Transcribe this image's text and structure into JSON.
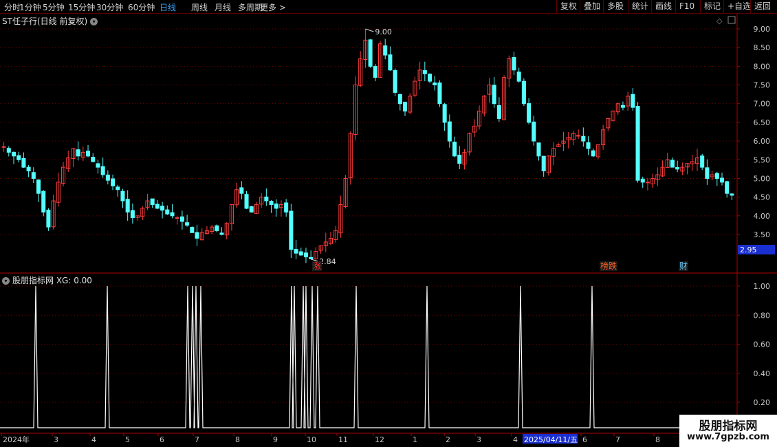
{
  "toolbar": {
    "periods": [
      "分时",
      "1分钟",
      "5分钟",
      "15分钟",
      "30分钟",
      "60分钟",
      "日线",
      "周线",
      "月线",
      "多周期",
      "更多 >"
    ],
    "active_period": "日线",
    "right_buttons": [
      "复权",
      "叠加",
      "多股",
      "统计",
      "画线",
      "F10",
      "标记",
      "+自选",
      "返回"
    ]
  },
  "main_chart": {
    "title": "ST任子行(日线 前复权)",
    "high_label": "9.00",
    "low_label": "2.84",
    "current_price": "2.95",
    "price_axis": [
      "9.00",
      "8.50",
      "8.00",
      "7.50",
      "7.00",
      "6.50",
      "6.00",
      "5.50",
      "5.00",
      "4.50",
      "4.00",
      "3.50"
    ],
    "markers": [
      {
        "text": "涨",
        "color": "#ff3030"
      },
      {
        "text": "榜跌",
        "color": "#ff6020"
      },
      {
        "text": "财",
        "color": "#66ccff"
      }
    ]
  },
  "indicator": {
    "title": "股朋指标网 XG: 0.00",
    "axis": [
      "1.00",
      "0.80",
      "0.60",
      "0.40",
      "0.20"
    ]
  },
  "time_axis": {
    "labels": [
      "2024年",
      "3",
      "4",
      "5",
      "6",
      "7",
      "8",
      "9",
      "10",
      "11",
      "12",
      "1",
      "2",
      "3",
      "4",
      "6",
      "7",
      "8"
    ],
    "highlight": "2025/04/11/五"
  },
  "watermark": {
    "line1": "股朋指标网",
    "line2": "www.7gpzb.com"
  },
  "colors": {
    "up": "#ff3c3c",
    "down": "#54ffff",
    "signal": "#ffffff",
    "grid": "#7a0000",
    "border": "#b00000",
    "price_tag_bg": "#1a2fd0"
  },
  "chart_data": {
    "type": "candlestick",
    "ylim": [
      2.84,
      9.0
    ],
    "close_path": [
      5.85,
      5.7,
      5.6,
      5.5,
      5.3,
      5.2,
      5.0,
      4.6,
      4.1,
      3.7,
      4.4,
      4.9,
      5.3,
      5.55,
      5.8,
      5.6,
      5.7,
      5.6,
      5.45,
      5.3,
      5.1,
      4.95,
      4.8,
      4.7,
      4.4,
      4.1,
      3.95,
      4.0,
      4.2,
      4.4,
      4.3,
      4.2,
      4.15,
      4.05,
      4.0,
      3.95,
      3.85,
      3.75,
      3.55,
      3.4,
      3.55,
      3.6,
      3.7,
      3.6,
      3.5,
      3.8,
      4.3,
      4.7,
      4.6,
      4.2,
      4.1,
      4.3,
      4.5,
      4.4,
      4.3,
      4.2,
      4.3,
      4.1,
      3.1,
      3.0,
      2.95,
      2.9,
      2.85,
      3.05,
      3.2,
      3.3,
      3.4,
      3.6,
      4.3,
      5.0,
      6.2,
      7.5,
      8.2,
      8.7,
      8.0,
      7.7,
      8.6,
      8.3,
      7.9,
      7.3,
      7.0,
      6.8,
      7.2,
      7.6,
      7.9,
      7.8,
      7.6,
      7.5,
      7.0,
      6.5,
      6.0,
      5.6,
      5.4,
      5.7,
      6.2,
      6.4,
      6.8,
      7.2,
      7.5,
      7.0,
      6.6,
      7.7,
      8.2,
      7.9,
      7.6,
      7.0,
      6.5,
      6.0,
      5.6,
      5.2,
      5.6,
      5.8,
      5.9,
      6.0,
      6.1,
      6.2,
      6.15,
      6.0,
      5.8,
      5.6,
      5.9,
      6.3,
      6.6,
      6.8,
      7.0,
      6.9,
      7.2,
      6.9,
      4.95,
      4.9,
      4.9,
      5.0,
      5.1,
      5.3,
      5.5,
      5.3,
      5.25,
      5.3,
      5.4,
      5.45,
      5.55,
      5.3,
      5.0,
      5.1,
      5.0,
      4.9,
      4.6,
      4.55
    ],
    "volatility_note": "",
    "xg_signals": [
      0,
      0,
      1,
      0,
      1,
      0,
      1,
      1,
      1,
      0,
      1,
      1,
      1,
      1,
      1,
      0,
      1,
      0,
      1,
      0,
      1,
      0,
      1
    ]
  }
}
